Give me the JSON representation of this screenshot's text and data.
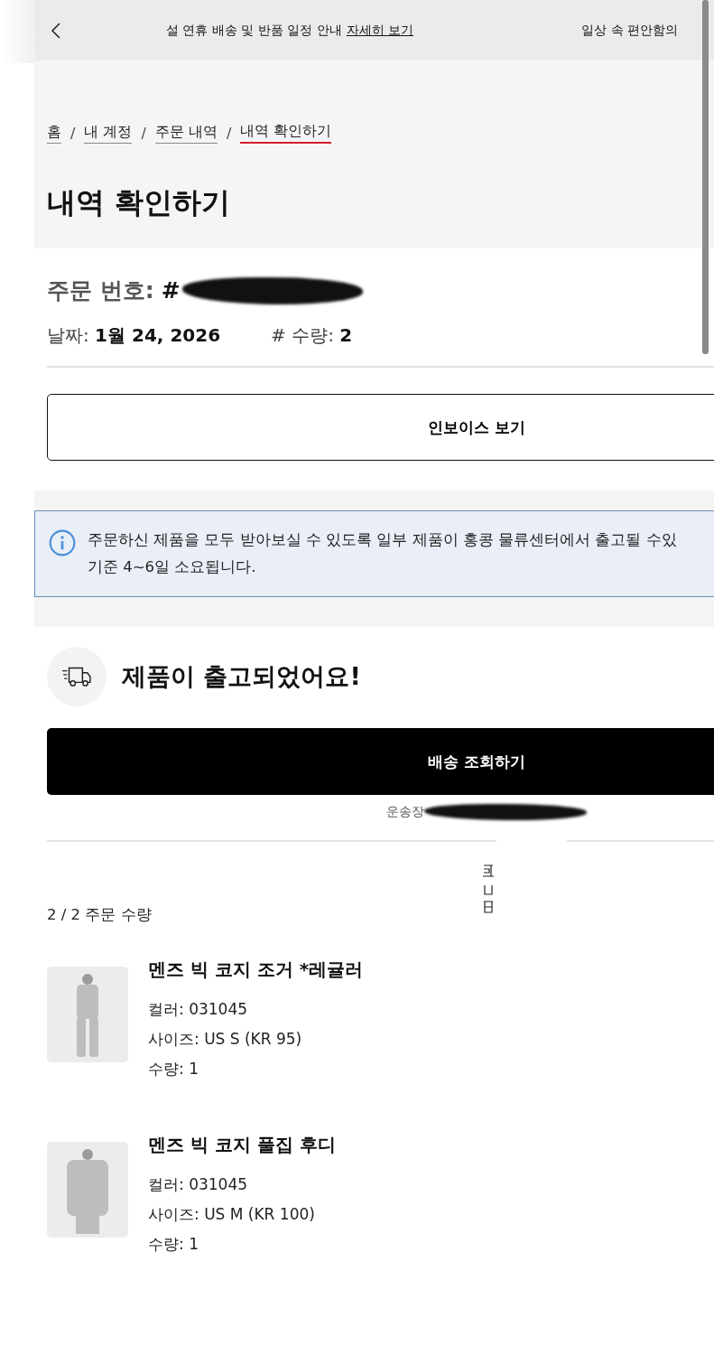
{
  "banner": {
    "message": "설 연휴 배송 및 반품 일정 안내",
    "link": "자세히 보기",
    "next_message": "일상 속 편안함의"
  },
  "breadcrumb_separator": "/",
  "breadcrumb": [
    {
      "label": "홈",
      "selected": false
    },
    {
      "label": "내 계정",
      "selected": false
    },
    {
      "label": "주문 내역",
      "selected": false
    },
    {
      "label": "내역 확인하기",
      "selected": true
    }
  ],
  "page_title": "내역 확인하기",
  "order": {
    "number_label": "주문 번호:",
    "number_prefix": "#",
    "date_label": "날짜:",
    "date": "1월 24, 2026",
    "quantity_label": "# 수량:",
    "quantity": "2"
  },
  "invoice_button": "인보이스 보기",
  "notice": "주문하신 제품을 모두 받아보실 수 있도록 일부 제품이 홍콩 물류센터에서 출고될 수있\n기준 4~6일 소요됩니다.",
  "shipment": {
    "title": "제품이 출고되었어요!",
    "track_button": "배송 조회하기",
    "tracking_label": "운송장"
  },
  "items_count": "2 / 2 주문 수량",
  "items": [
    {
      "name": "멘즈 빅 코지 조거 *레귤러",
      "color_code": "컬러: 031045",
      "size": "사이즈: US S (KR 95)",
      "quantity": "수량: 1",
      "kind": "pants"
    },
    {
      "name": "멘즈 빅 코지 풀집 후디",
      "color_code": "컬러: 031045",
      "size": "사이즈: US M (KR 100)",
      "quantity": "수량: 1",
      "kind": "hoodie"
    }
  ]
}
